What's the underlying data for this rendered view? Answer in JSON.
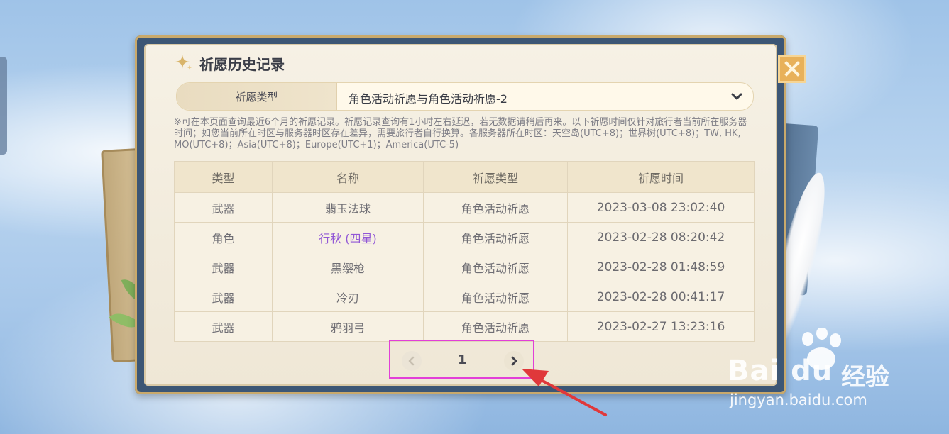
{
  "dialog": {
    "title": "祈愿历史记录",
    "type_label": "祈愿类型",
    "type_value": "角色活动祈愿与角色活动祈愿-2",
    "notice": "※可在本页面查询最近6个月的祈愿记录。祈愿记录查询有1小时左右延迟，若无数据请稍后再来。以下祈愿时间仅针对旅行者当前所在服务器时间；如您当前所在时区与服务器时区存在差异，需要旅行者自行换算。各服务器所在时区：天空岛(UTC+8)；世界树(UTC+8)；TW, HK, MO(UTC+8)；Asia(UTC+8)；Europe(UTC+1)；America(UTC-5)"
  },
  "table": {
    "headers": [
      "类型",
      "名称",
      "祈愿类型",
      "祈愿时间"
    ],
    "rows": [
      {
        "type": "武器",
        "name": "翡玉法球",
        "wish": "角色活动祈愿",
        "time": "2023-03-08 23:02:40"
      },
      {
        "type": "角色",
        "name": "行秋 (四星)",
        "wish": "角色活动祈愿",
        "time": "2023-02-28 08:20:42"
      },
      {
        "type": "武器",
        "name": "黑缨枪",
        "wish": "角色活动祈愿",
        "time": "2023-02-28 01:48:59"
      },
      {
        "type": "武器",
        "name": "冷刃",
        "wish": "角色活动祈愿",
        "time": "2023-02-28 00:41:17"
      },
      {
        "type": "武器",
        "name": "鸦羽弓",
        "wish": "角色活动祈愿",
        "time": "2023-02-27 13:23:16"
      }
    ]
  },
  "pagination": {
    "current_page": "1"
  },
  "watermark": {
    "brand": "Bai du",
    "cn": "经验",
    "url": "jingyan.baidu.com"
  },
  "colors": {
    "four_star": "#9157d6",
    "highlight_box": "#e23fd8",
    "close_button": "#e8b15a",
    "frame": "#3c5675"
  },
  "icons": [
    "sparkle-icon",
    "close-icon",
    "chevron-down-icon",
    "chevron-left-icon",
    "chevron-right-icon",
    "arrow-annotation",
    "paw-logo"
  ]
}
